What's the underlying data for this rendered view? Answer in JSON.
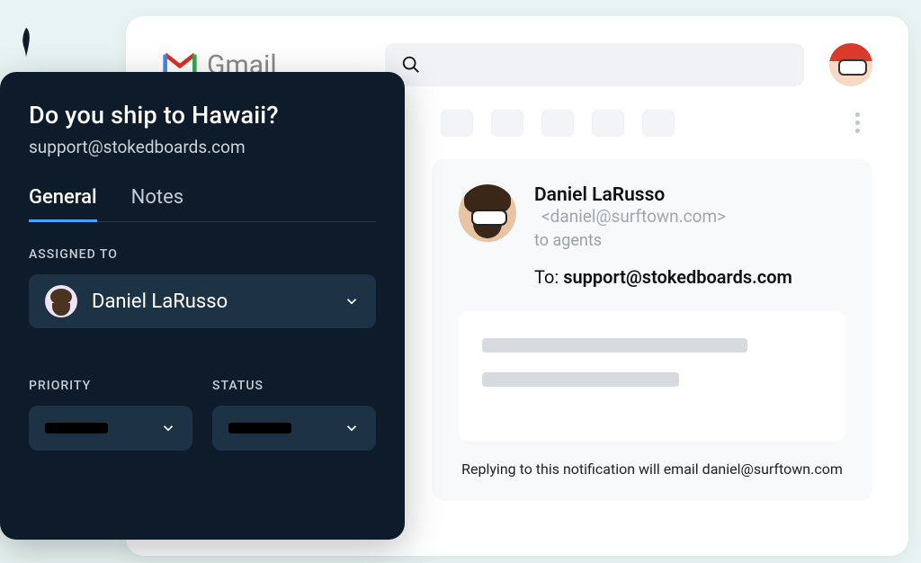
{
  "brand": {
    "name": "Gmail"
  },
  "search": {
    "placeholder": ""
  },
  "email": {
    "sender_name": "Daniel LaRusso",
    "sender_email": "<daniel@surftown.com>",
    "recipients_label": "to agents",
    "to_label": "To: ",
    "to_address": "support@stokedboards.com",
    "reply_note": "Replying to this notification will email daniel@surftown.com"
  },
  "ticket": {
    "title": "Do you ship to Hawaii?",
    "subtitle": "support@stokedboards.com",
    "tabs": {
      "general": "General",
      "notes": "Notes"
    },
    "assigned_label": "ASSIGNED TO",
    "assigned_value": "Daniel LaRusso",
    "priority_label": "PRIORITY",
    "priority_value": "",
    "status_label": "STATUS",
    "status_value": ""
  }
}
